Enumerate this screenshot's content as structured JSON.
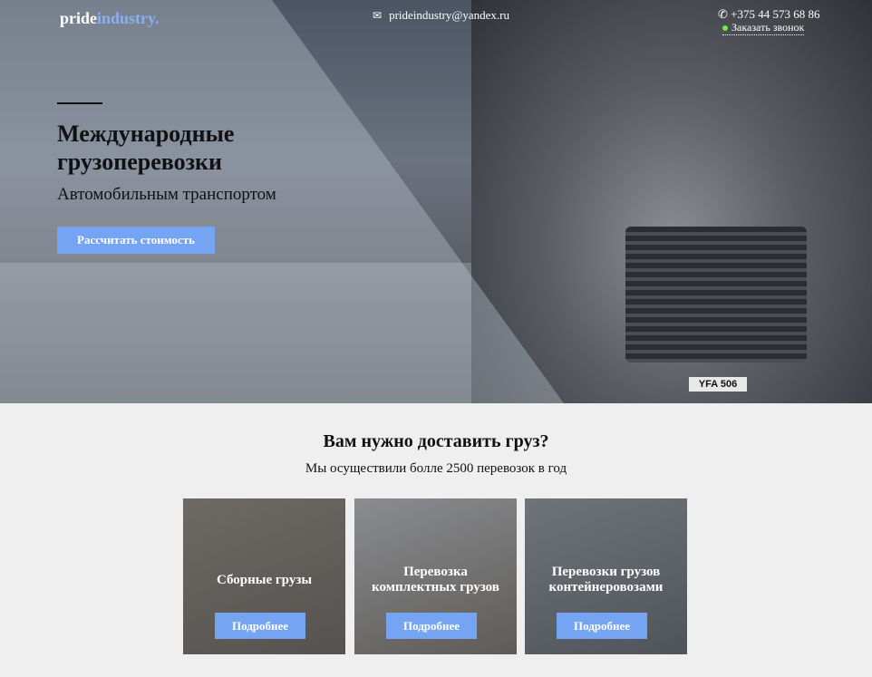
{
  "header": {
    "logo_a": "pride",
    "logo_b": "industry.",
    "email": "prideindustry@yandex.ru",
    "phone": "+375 44 573 68 86",
    "callback": "Заказать звонок"
  },
  "hero": {
    "title": "Международные грузоперевозки",
    "subtitle": "Автомобильным транспортом",
    "cta": "Рассчитать стоимость",
    "plate": "YFA 506"
  },
  "section": {
    "title": "Вам нужно доставить груз?",
    "lead": "Мы осуществили болле 2500 перевозок в год"
  },
  "cards": [
    {
      "title": "Сборные грузы",
      "button": "Подробнее"
    },
    {
      "title": "Перевозка комплектных грузов",
      "button": "Подробнее"
    },
    {
      "title": "Перевозки грузов контейнеровозами",
      "button": "Подробнее"
    }
  ],
  "colors": {
    "accent": "#74a4f2",
    "status_dot": "#6cf03a"
  }
}
